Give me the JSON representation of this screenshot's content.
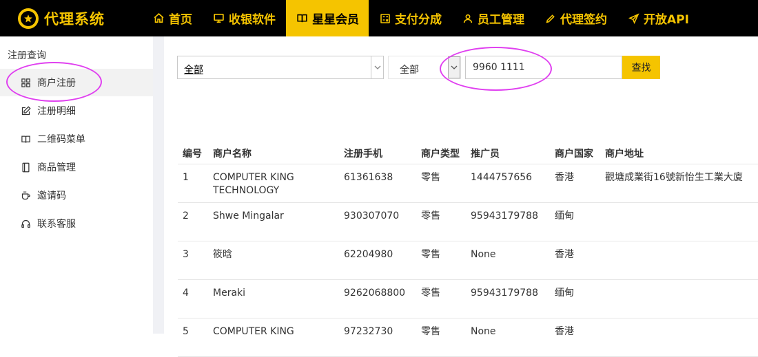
{
  "app": {
    "title": "代理系统"
  },
  "nav": [
    {
      "label": "首页",
      "icon": "home-icon"
    },
    {
      "label": "收银软件",
      "icon": "monitor-icon"
    },
    {
      "label": "星星会员",
      "icon": "book-icon"
    },
    {
      "label": "支付分成",
      "icon": "calculator-icon"
    },
    {
      "label": "员工管理",
      "icon": "user-icon"
    },
    {
      "label": "代理签约",
      "icon": "pen-icon"
    },
    {
      "label": "开放API",
      "icon": "send-icon"
    }
  ],
  "nav_active": "星星会员",
  "sidebar": {
    "group_title": "注册查询",
    "items": [
      {
        "label": "商户注册",
        "icon": "grid-icon"
      },
      {
        "label": "注册明细",
        "icon": "edit-icon"
      },
      {
        "label": "二维码菜单",
        "icon": "book-icon"
      },
      {
        "label": "商品管理",
        "icon": "tablet-icon"
      },
      {
        "label": "邀请码",
        "icon": "cup-icon"
      },
      {
        "label": "联系客服",
        "icon": "headset-icon"
      }
    ],
    "active": "商户注册"
  },
  "filters": {
    "type_select": "全部",
    "country_select": "全部",
    "search_value": "9960 1111",
    "search_button": "查找"
  },
  "table": {
    "headers": [
      "编号",
      "商户名称",
      "注册手机",
      "商户类型",
      "推广员",
      "商户国家",
      "商户地址"
    ],
    "rows": [
      {
        "no": "1",
        "name_line1": "COMPUTER KING",
        "name_line2": "TECHNOLOGY",
        "phone": "61361638",
        "type": "零售",
        "promoter": "1444757656",
        "country": "香港",
        "address": "觀塘成業街16號新怡生工業大廈"
      },
      {
        "no": "2",
        "name_line1": "Shwe Mingalar",
        "name_line2": "",
        "phone": "930307070",
        "type": "零售",
        "promoter": "95943179788",
        "country": "缅甸",
        "address": ""
      },
      {
        "no": "3",
        "name_line1": "筱晗",
        "name_line2": "",
        "phone": "62204980",
        "type": "零售",
        "promoter": "None",
        "country": "香港",
        "address": ""
      },
      {
        "no": "4",
        "name_line1": "Meraki",
        "name_line2": "",
        "phone": "9262068800",
        "type": "零售",
        "promoter": "95943179788",
        "country": "缅甸",
        "address": ""
      },
      {
        "no": "5",
        "name_line1": "COMPUTER KING",
        "name_line2": "",
        "phone": "97232730",
        "type": "零售",
        "promoter": "None",
        "country": "香港",
        "address": ""
      }
    ]
  },
  "colors": {
    "accent": "#f5c400",
    "topbar": "#000000",
    "annotation_circle": "#e040f0"
  }
}
